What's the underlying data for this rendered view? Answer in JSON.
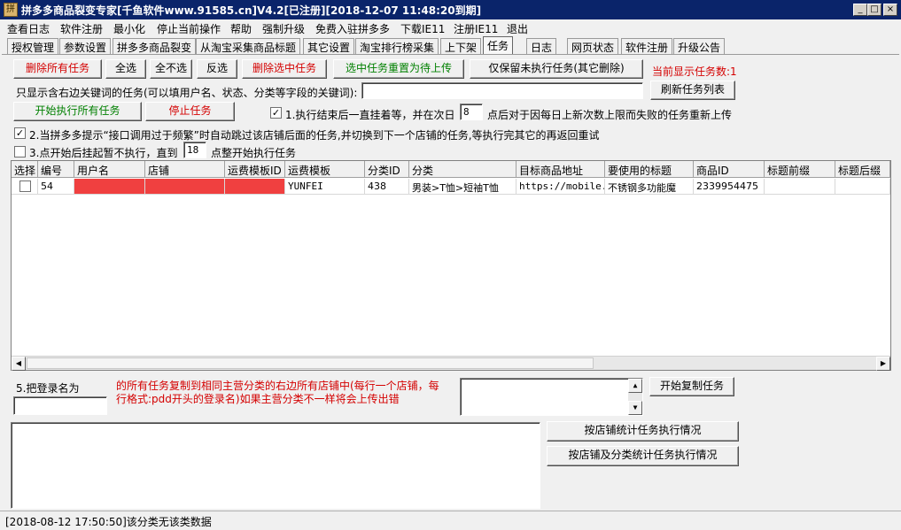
{
  "window": {
    "title": "拼多多商品裂变专家[千鱼软件www.91585.cn]V4.2[已注册][2018-12-07 11:48:20到期]",
    "app_icon_glyph": "拼",
    "min_glyph": "_",
    "max_glyph": "□",
    "close_glyph": "×"
  },
  "menu": [
    "查看日志",
    "软件注册",
    "最小化",
    "停止当前操作",
    "帮助",
    "强制升级",
    "免费入驻拼多多",
    "下载IE11",
    "注册IE11",
    "退出"
  ],
  "tabs": [
    "授权管理",
    "参数设置",
    "拼多多商品裂变",
    "从淘宝采集商品标题",
    "其它设置",
    "淘宝排行榜采集",
    "上下架",
    "任务",
    "日志",
    "网页状态",
    "软件注册",
    "升级公告"
  ],
  "active_tab": "任务",
  "toolbar": {
    "delete_all": "删除所有任务",
    "select_all": "全选",
    "select_none": "全不选",
    "invert": "反选",
    "delete_selected": "删除选中任务",
    "reset_selected": "选中任务重置为待上传",
    "keep_unexecuted": "仅保留未执行任务(其它删除)",
    "task_count_label": "当前显示任务数:1"
  },
  "filter": {
    "label": "只显示含右边关键词的任务(可以填用户名、状态、分类等字段的关键词):",
    "value": "",
    "refresh_button": "刷新任务列表"
  },
  "exec": {
    "start_all": "开始执行所有任务",
    "stop": "停止任务"
  },
  "option1": {
    "checked": true,
    "label": "1.执行结束后一直挂着等，并在次日",
    "hour_value": "8",
    "suffix": "点后对于因每日上新次数上限而失败的任务重新上传"
  },
  "option2": {
    "checked": true,
    "label": "2.当拼多多提示“接口调用过于频繁”时自动跳过该店铺后面的任务,并切换到下一个店铺的任务,等执行完其它的再返回重试"
  },
  "option3": {
    "checked": false,
    "label": "3.点开始后挂起暂不执行，直到",
    "hour_value": "18",
    "suffix": "点整开始执行任务"
  },
  "grid": {
    "columns": [
      "选择",
      "编号",
      "用户名",
      "店铺",
      "运费模板ID",
      "运费模板",
      "分类ID",
      "分类",
      "目标商品地址",
      "要使用的标题",
      "商品ID",
      "标题前缀",
      "标题后缀"
    ],
    "rows": [
      {
        "checked": false,
        "id": "54",
        "username": "",
        "shop": "",
        "freight_id": "",
        "freight_template": "YUNFEI",
        "category_id": "438",
        "category": "男装>T恤>短袖T恤",
        "url": "https://mobile.",
        "title": "不锈钢多功能魔",
        "product_id": "2339954475",
        "title_prefix": "",
        "title_suffix": ""
      }
    ],
    "redacted_color": "#f04040"
  },
  "copy": {
    "label": "5.把登录名为",
    "login_value": "",
    "description": "的所有任务复制到相同主营分类的右边所有店铺中(每行一个店铺，每行格式:pdd开头的登录名)如果主营分类不一样将会上传出错",
    "shops_value": "",
    "start_button": "开始复制任务"
  },
  "stats": {
    "log_value": "",
    "by_shop_button": "按店铺统计任务执行情况",
    "by_shop_category_button": "按店铺及分类统计任务执行情况"
  },
  "status_bar": "[2018-08-12 17:50:50]该分类无该类数据"
}
